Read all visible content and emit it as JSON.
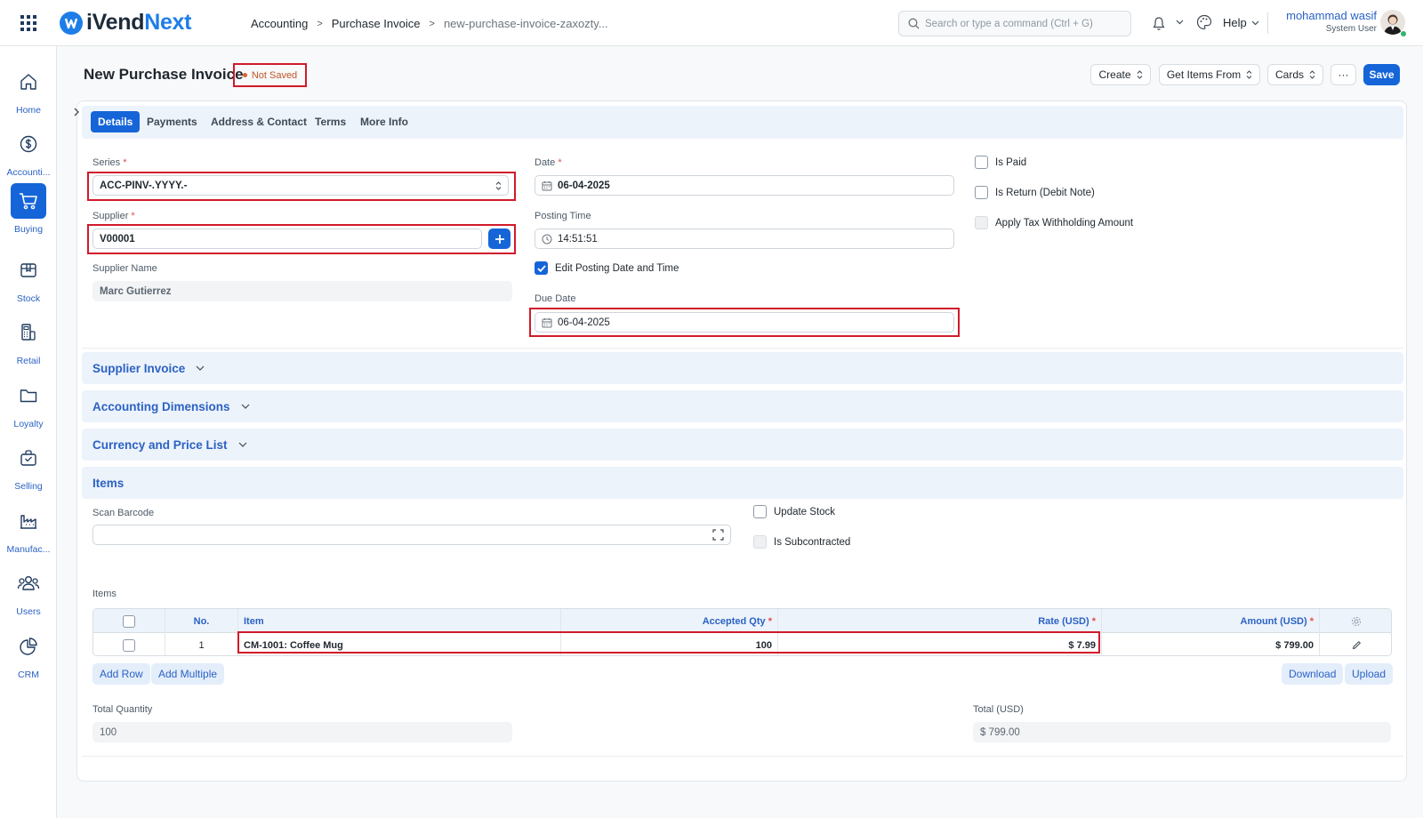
{
  "brand": {
    "name_part1": "iVend",
    "name_part2": "Next"
  },
  "breadcrumb": {
    "items": [
      "Accounting",
      "Purchase Invoice",
      "new-purchase-invoice-zaxozty..."
    ]
  },
  "search": {
    "placeholder": "Search or type a command (Ctrl + G)"
  },
  "help": {
    "label": "Help"
  },
  "user": {
    "name": "mohammad wasif",
    "role": "System User"
  },
  "sidebar": {
    "items": [
      {
        "label": "Home",
        "icon": "home-icon"
      },
      {
        "label": "Accounti...",
        "icon": "dollar-icon"
      },
      {
        "label": "Buying",
        "icon": "cart-icon",
        "active": true
      },
      {
        "label": "Stock",
        "icon": "box-icon"
      },
      {
        "label": "Retail",
        "icon": "register-icon"
      },
      {
        "label": "Loyalty",
        "icon": "folder-icon"
      },
      {
        "label": "Selling",
        "icon": "bag-icon"
      },
      {
        "label": "Manufac...",
        "icon": "factory-icon"
      },
      {
        "label": "Users",
        "icon": "users-icon"
      },
      {
        "label": "CRM",
        "icon": "pie-icon"
      }
    ]
  },
  "page": {
    "title": "New Purchase Invoice",
    "status": "Not Saved"
  },
  "actions": {
    "create": "Create",
    "get_items": "Get Items From",
    "cards": "Cards",
    "more": "···",
    "save": "Save"
  },
  "tabs": [
    "Details",
    "Payments",
    "Address & Contact",
    "Terms",
    "More Info"
  ],
  "form": {
    "series": {
      "label": "Series",
      "value": "ACC-PINV-.YYYY.-"
    },
    "supplier": {
      "label": "Supplier",
      "value": "V00001"
    },
    "supplier_name": {
      "label": "Supplier Name",
      "value": "Marc Gutierrez"
    },
    "date": {
      "label": "Date",
      "value": "06-04-2025"
    },
    "posting_time": {
      "label": "Posting Time",
      "value": "14:51:51"
    },
    "edit_posting": {
      "label": "Edit Posting Date and Time",
      "checked": true
    },
    "due_date": {
      "label": "Due Date",
      "value": "06-04-2025"
    },
    "is_paid": {
      "label": "Is Paid",
      "checked": false
    },
    "is_return": {
      "label": "Is Return (Debit Note)",
      "checked": false
    },
    "apply_tax": {
      "label": "Apply Tax Withholding Amount",
      "checked": false
    }
  },
  "sections": {
    "supplier_invoice": "Supplier Invoice",
    "accounting_dimensions": "Accounting Dimensions",
    "currency_price_list": "Currency and Price List",
    "items": "Items"
  },
  "items_section": {
    "scan_barcode": {
      "label": "Scan Barcode",
      "value": ""
    },
    "update_stock": {
      "label": "Update Stock",
      "checked": false
    },
    "is_subcontracted": {
      "label": "Is Subcontracted",
      "checked": false
    },
    "table_label": "Items",
    "columns": {
      "no": "No.",
      "item": "Item",
      "qty": "Accepted Qty",
      "rate": "Rate (USD)",
      "amount": "Amount (USD)"
    },
    "rows": [
      {
        "no": "1",
        "item": "CM-1001: Coffee Mug",
        "qty": "100",
        "rate": "$ 7.99",
        "amount": "$ 799.00"
      }
    ],
    "buttons": {
      "add_row": "Add Row",
      "add_multiple": "Add Multiple",
      "download": "Download",
      "upload": "Upload"
    }
  },
  "totals": {
    "quantity": {
      "label": "Total Quantity",
      "value": "100"
    },
    "total": {
      "label": "Total (USD)",
      "value": "$ 799.00"
    }
  },
  "colors": {
    "primary": "#1565d8",
    "highlight": "#d11a2a",
    "link": "#2b62c4"
  }
}
